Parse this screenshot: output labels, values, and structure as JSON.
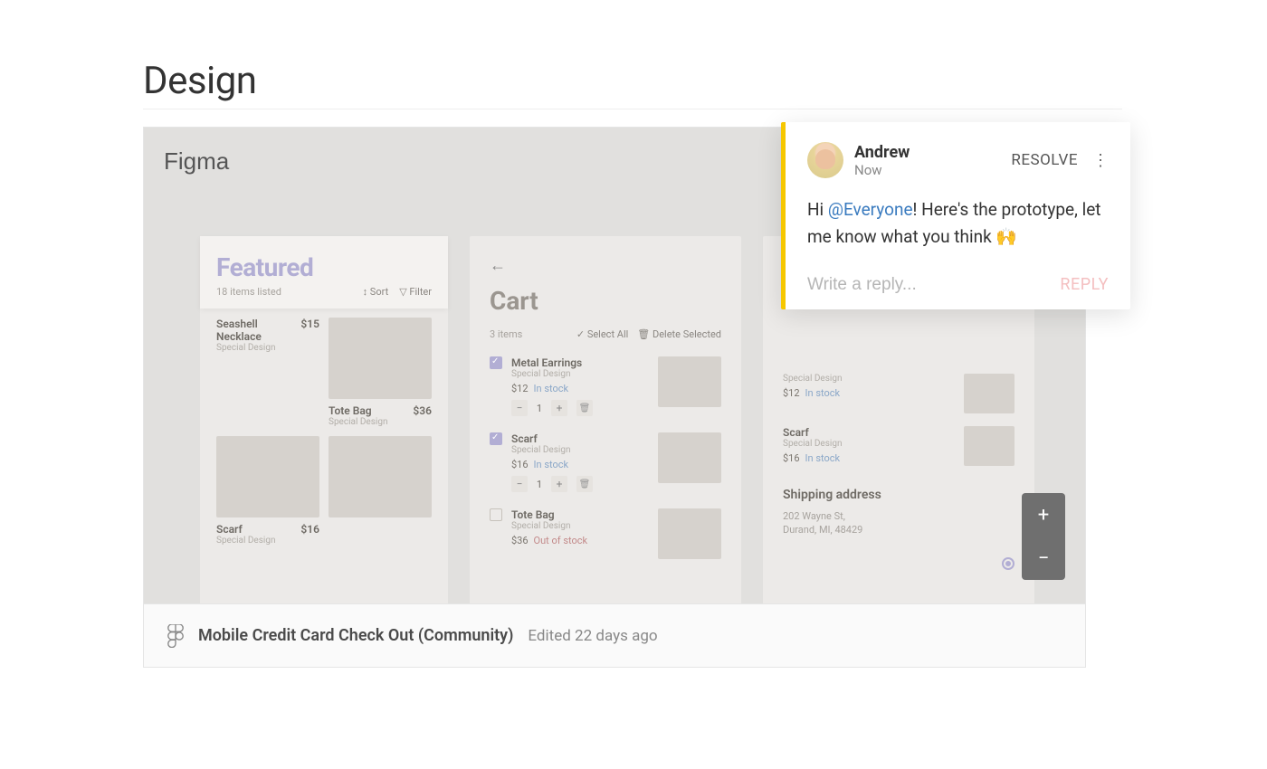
{
  "page": {
    "title": "Design"
  },
  "embed": {
    "provider": "Figma",
    "file_name": "Mobile Credit Card Check Out (Community)",
    "edited": "Edited 22 days ago"
  },
  "featured": {
    "title": "Featured",
    "subtitle": "18 items listed",
    "sort_label": "Sort",
    "filter_label": "Filter",
    "products": [
      {
        "name": "Seashell Necklace",
        "price": "$15",
        "meta": "Special Design"
      },
      {
        "name": "Tote Bag",
        "price": "$36",
        "meta": "Special Design"
      },
      {
        "name": "Scarf",
        "price": "$16",
        "meta": "Special Design"
      },
      {
        "name": "",
        "price": "",
        "meta": ""
      }
    ]
  },
  "cart": {
    "title": "Cart",
    "subtitle": "3 items",
    "select_all": "Select All",
    "delete_selected": "Delete Selected",
    "items": [
      {
        "name": "Metal Earrings",
        "meta": "Special Design",
        "price": "$12",
        "stock": "In stock",
        "qty": "1",
        "checked": true
      },
      {
        "name": "Scarf",
        "meta": "Special Design",
        "price": "$16",
        "stock": "In stock",
        "qty": "1",
        "checked": true
      },
      {
        "name": "Tote Bag",
        "meta": "Special Design",
        "price": "$36",
        "stock": "Out of stock",
        "qty": "",
        "checked": false
      }
    ]
  },
  "checkout": {
    "items": [
      {
        "name": "",
        "meta": "Special Design",
        "price": "$12",
        "stock": "In stock"
      },
      {
        "name": "Scarf",
        "meta": "Special Design",
        "price": "$16",
        "stock": "In stock"
      }
    ],
    "shipping_title": "Shipping address",
    "address_line1": "202 Wayne St,",
    "address_line2": "Durand, MI, 48429"
  },
  "comment": {
    "author": "Andrew",
    "time": "Now",
    "resolve": "RESOLVE",
    "body_prefix": "Hi ",
    "mention": "@Everyone",
    "body_suffix": "! Here's the prototype, let me know what you think 🙌",
    "reply_placeholder": "Write a reply...",
    "reply_button": "REPLY"
  },
  "zoom": {
    "in": "+",
    "out": "−"
  }
}
